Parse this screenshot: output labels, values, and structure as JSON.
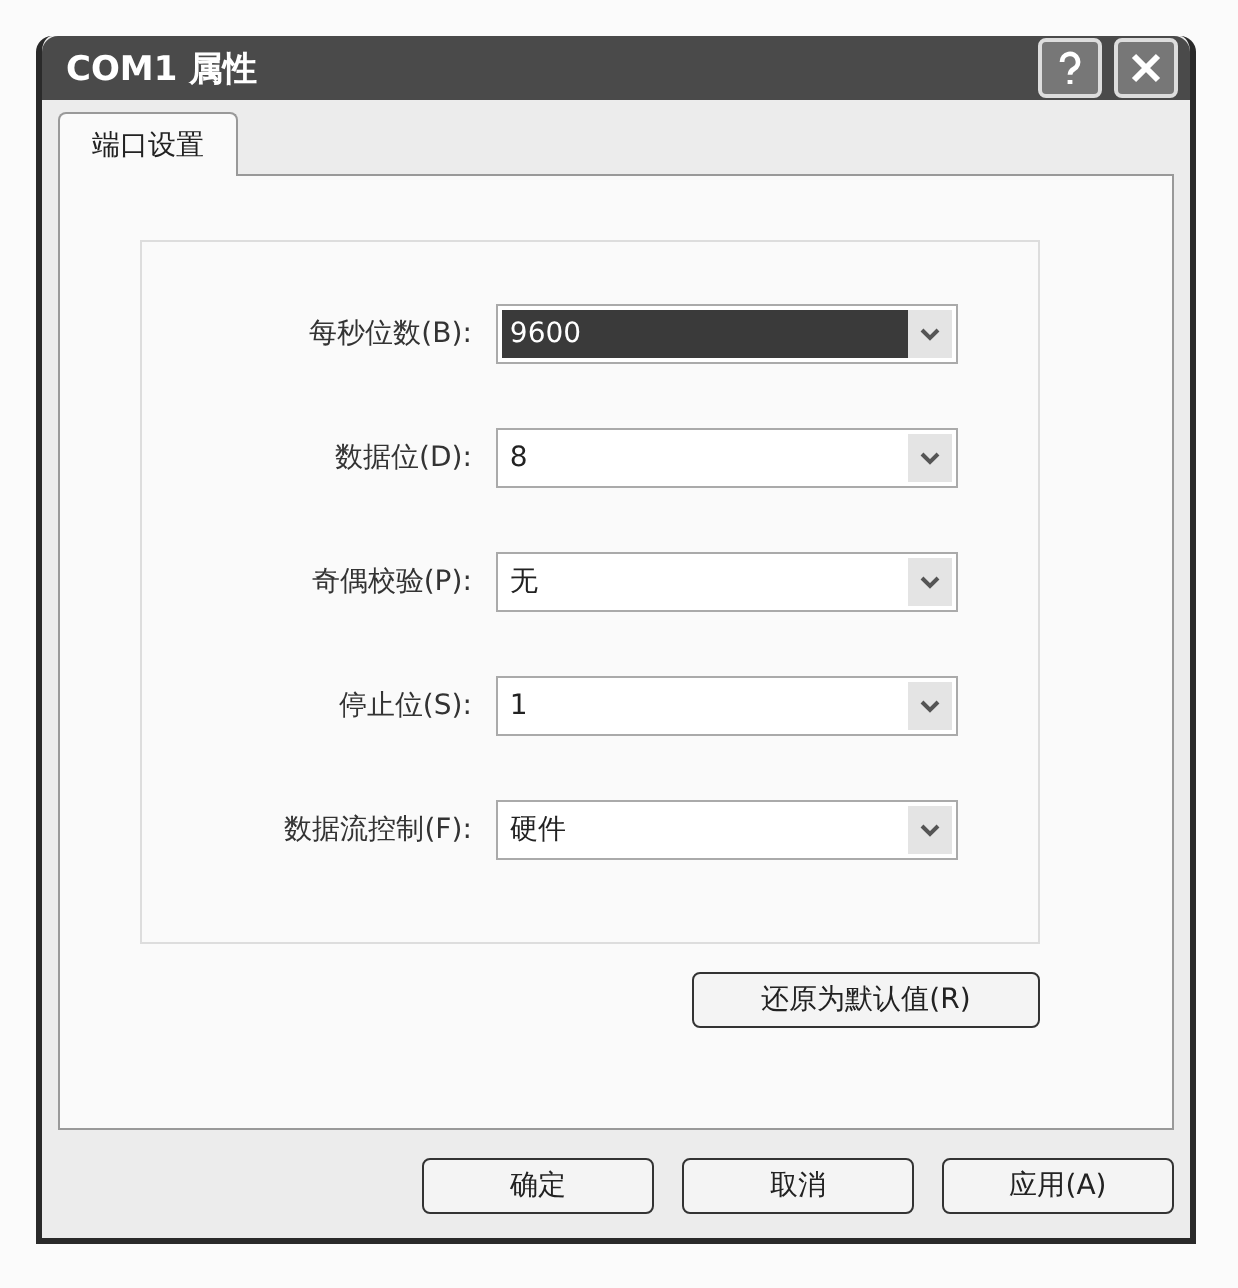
{
  "window": {
    "title": "COM1 属性"
  },
  "tabs": [
    {
      "label": "端口设置",
      "selected": true
    }
  ],
  "fields": [
    {
      "label": "每秒位数(B):",
      "value": "9600",
      "highlighted": true
    },
    {
      "label": "数据位(D):",
      "value": "8",
      "highlighted": false
    },
    {
      "label": "奇偶校验(P):",
      "value": "无",
      "highlighted": false
    },
    {
      "label": "停止位(S):",
      "value": "1",
      "highlighted": false
    },
    {
      "label": "数据流控制(F):",
      "value": "硬件",
      "highlighted": false
    }
  ],
  "restore_button": "还原为默认值(R)",
  "buttons": [
    "确定",
    "取消",
    "应用(A)"
  ]
}
